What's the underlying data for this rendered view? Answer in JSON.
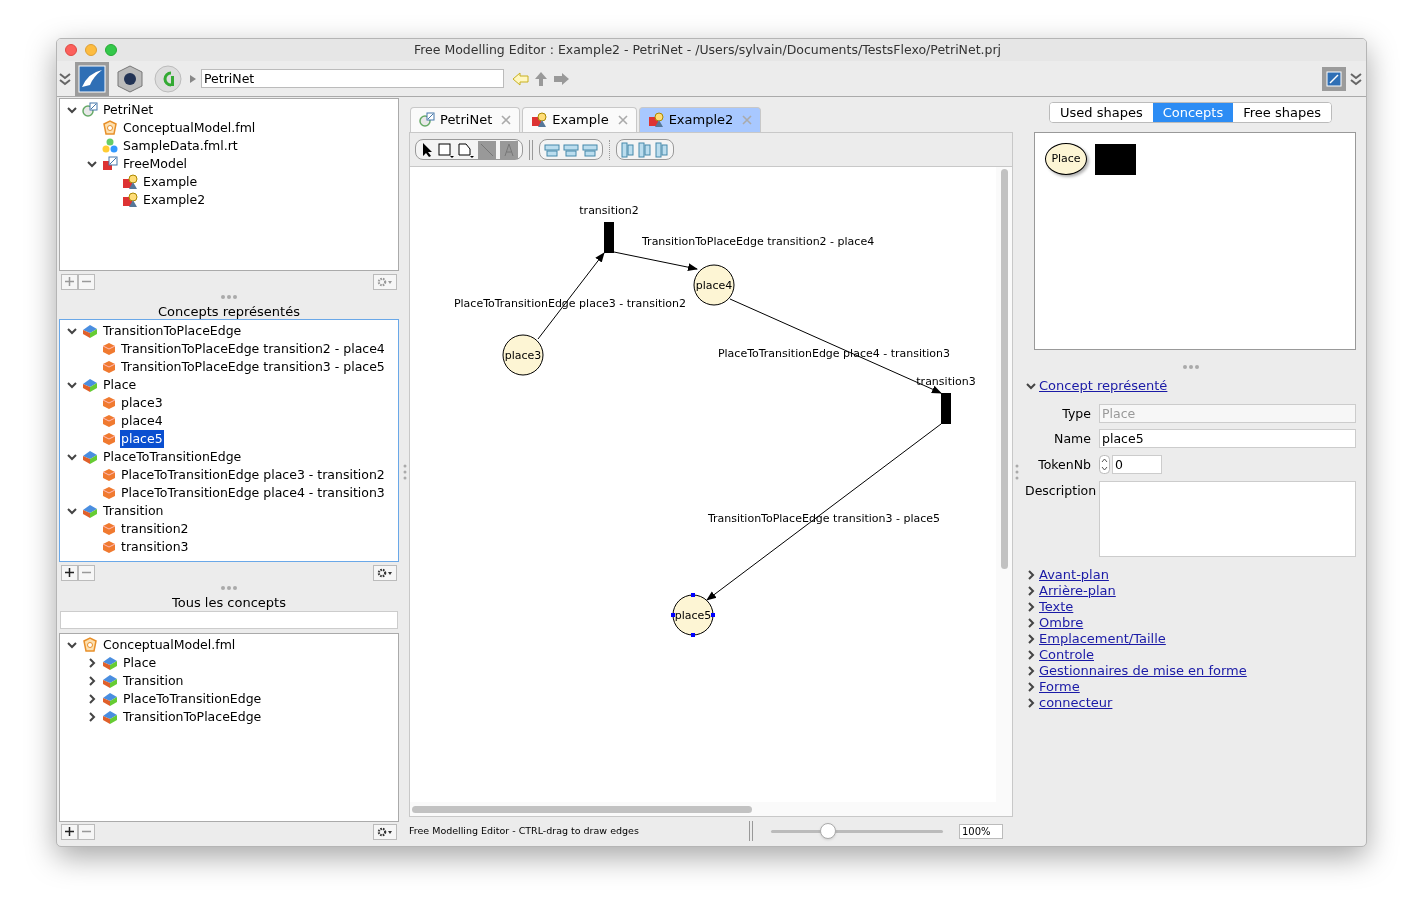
{
  "window": {
    "title": "Free Modelling Editor : Example2 - PetriNet - /Users/sylvain/Documents/TestsFlexo/PetriNet.prj"
  },
  "toolbar": {
    "path": "PetriNet"
  },
  "project_tree": [
    {
      "label": "PetriNet",
      "kind": "project",
      "expanded": true,
      "selected": false,
      "children": [
        {
          "label": "ConceptualModel.fml",
          "kind": "model",
          "selected": false
        },
        {
          "label": "SampleData.fml.rt",
          "kind": "data",
          "selected": false
        },
        {
          "label": "FreeModel",
          "kind": "freemodel",
          "expanded": true,
          "selected": false,
          "children": [
            {
              "label": "Example",
              "kind": "diagram",
              "selected": false
            },
            {
              "label": "Example2",
              "kind": "diagram",
              "selected": false
            }
          ]
        }
      ]
    }
  ],
  "concepts_panel": {
    "title": "Concepts représentés",
    "tree": [
      {
        "label": "TransitionToPlaceEdge",
        "kind": "concept",
        "expanded": true,
        "selected": false,
        "children": [
          {
            "label": "TransitionToPlaceEdge transition2 - place4",
            "kind": "instance",
            "selected": false
          },
          {
            "label": "TransitionToPlaceEdge transition3 - place5",
            "kind": "instance",
            "selected": false
          }
        ]
      },
      {
        "label": "Place",
        "kind": "concept",
        "expanded": true,
        "selected": false,
        "children": [
          {
            "label": "place3",
            "kind": "instance",
            "selected": false
          },
          {
            "label": "place4",
            "kind": "instance",
            "selected": false
          },
          {
            "label": "place5",
            "kind": "instance",
            "selected": true
          }
        ]
      },
      {
        "label": "PlaceToTransitionEdge",
        "kind": "concept",
        "expanded": true,
        "selected": false,
        "children": [
          {
            "label": "PlaceToTransitionEdge place3 - transition2",
            "kind": "instance",
            "selected": false
          },
          {
            "label": "PlaceToTransitionEdge place4 - transition3",
            "kind": "instance",
            "selected": false
          }
        ]
      },
      {
        "label": "Transition",
        "kind": "concept",
        "expanded": true,
        "selected": false,
        "children": [
          {
            "label": "transition2",
            "kind": "instance",
            "selected": false
          },
          {
            "label": "transition3",
            "kind": "instance",
            "selected": false
          }
        ]
      }
    ]
  },
  "all_concepts_panel": {
    "title": "Tous les concepts",
    "tree": [
      {
        "label": "ConceptualModel.fml",
        "kind": "model",
        "expanded": true,
        "selected": false,
        "children": [
          {
            "label": "Place",
            "kind": "concept",
            "expanded": false,
            "selected": false
          },
          {
            "label": "Transition",
            "kind": "concept",
            "expanded": false,
            "selected": false
          },
          {
            "label": "PlaceToTransitionEdge",
            "kind": "concept",
            "expanded": false,
            "selected": false
          },
          {
            "label": "TransitionToPlaceEdge",
            "kind": "concept",
            "expanded": false,
            "selected": false
          }
        ]
      }
    ]
  },
  "editor_tabs": [
    {
      "label": "PetriNet",
      "kind": "project",
      "selected": false
    },
    {
      "label": "Example",
      "kind": "diagram",
      "selected": false
    },
    {
      "label": "Example2",
      "kind": "diagram",
      "selected": true
    }
  ],
  "diagram": {
    "nodes": [
      {
        "label": "transition2",
        "kind": "transition",
        "selected": false
      },
      {
        "label": "place4",
        "kind": "place",
        "selected": false
      },
      {
        "label": "place3",
        "kind": "place",
        "selected": false
      },
      {
        "label": "transition3",
        "kind": "transition",
        "selected": false
      },
      {
        "label": "place5",
        "kind": "place",
        "selected": true
      }
    ],
    "edges": [
      {
        "label": "PlaceToTransitionEdge place3 - transition2"
      },
      {
        "label": "TransitionToPlaceEdge transition2 - place4"
      },
      {
        "label": "PlaceToTransitionEdge place4 - transition3"
      },
      {
        "label": "TransitionToPlaceEdge transition3 - place5"
      }
    ]
  },
  "status_bar": {
    "text": "Free Modelling Editor - CTRL-drag to draw edges",
    "zoom": {
      "level": 0.33,
      "value": "100%"
    }
  },
  "palette_tabs": [
    {
      "label": "Used shapes",
      "selected": false
    },
    {
      "label": "Concepts",
      "selected": true
    },
    {
      "label": "Free shapes",
      "selected": false
    }
  ],
  "palette": {
    "items": [
      {
        "label": "Place",
        "kind": "place"
      },
      {
        "kind": "transition"
      }
    ]
  },
  "inspector": {
    "section": {
      "title": "Concept représenté",
      "expanded": true
    },
    "fields": [
      {
        "label": "Type",
        "value": "Place",
        "disabled": true,
        "kind": "text"
      },
      {
        "label": "Name",
        "value": "place5",
        "disabled": false,
        "kind": "text"
      },
      {
        "label": "TokenNb",
        "value": "0",
        "disabled": false,
        "kind": "spinner"
      },
      {
        "label": "Description",
        "disabled": false,
        "kind": "textarea"
      }
    ],
    "collapsed_sections": [
      "Avant-plan",
      "Arrière-plan",
      "Texte",
      "Ombre",
      "Emplacement/Taille",
      "Controle",
      "Gestionnaires de mise en forme",
      "Forme",
      "connecteur"
    ]
  }
}
